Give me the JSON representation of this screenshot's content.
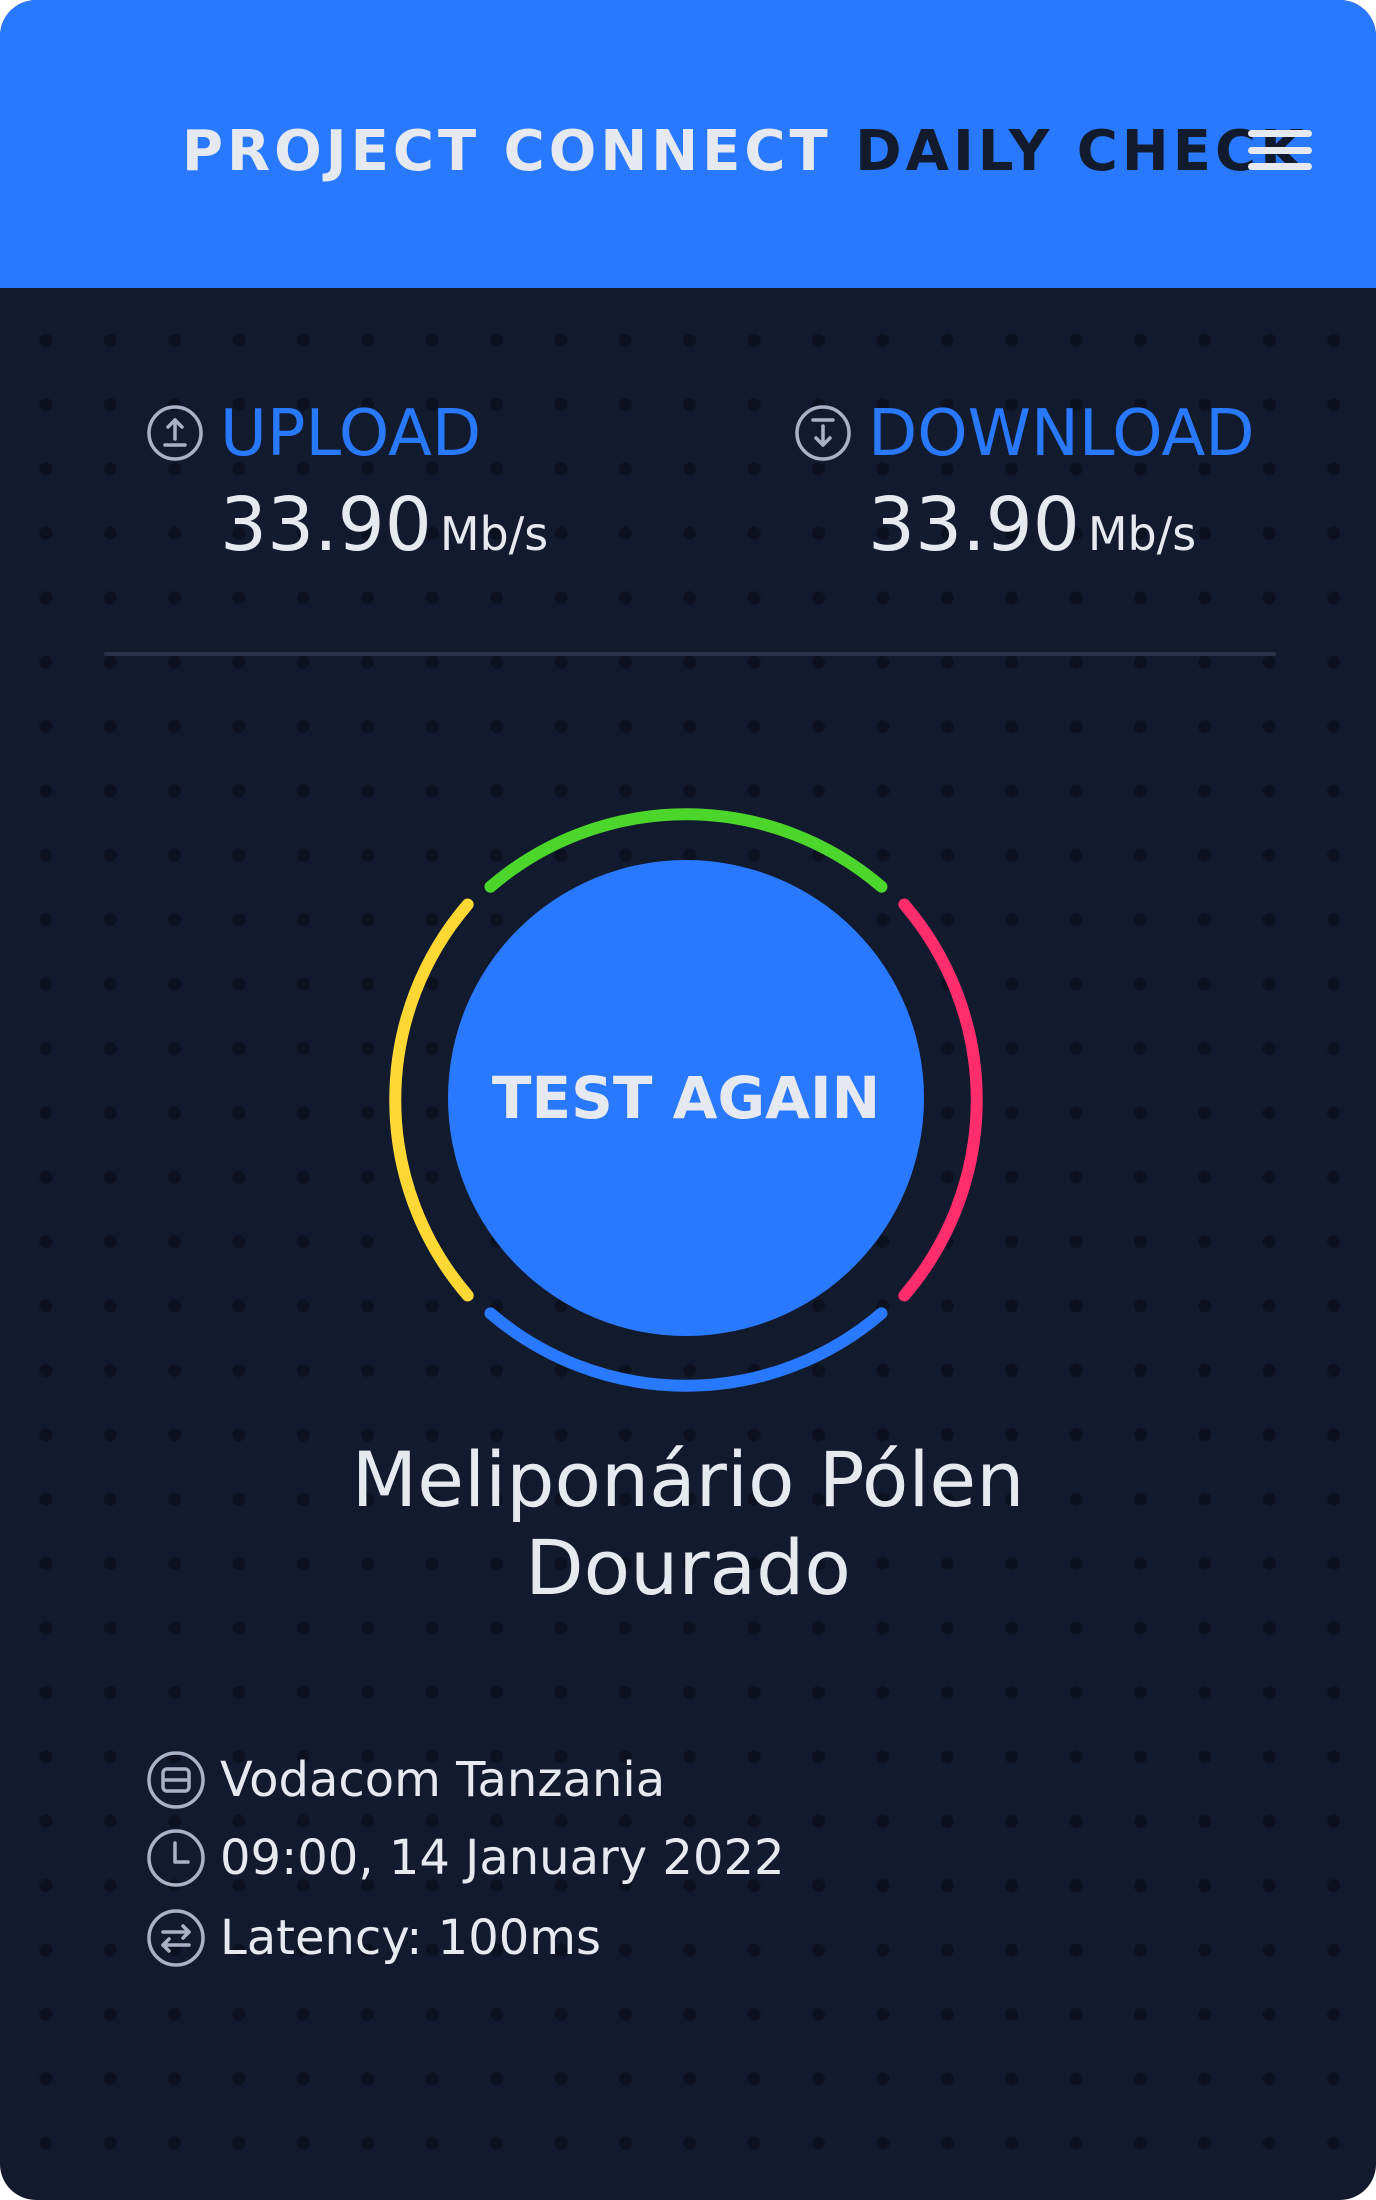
{
  "header": {
    "title_part1": "PROJECT CONNECT",
    "title_part2": "DAILY CHECK",
    "menu_icon": "hamburger-menu-icon"
  },
  "upload": {
    "icon": "upload-circle-icon",
    "label": "UPLOAD",
    "value": "33.90",
    "unit": "Mb/s"
  },
  "download": {
    "icon": "download-circle-icon",
    "label": "DOWNLOAD",
    "value": "33.90",
    "unit": "Mb/s"
  },
  "gauge": {
    "segment_colors": [
      "#4cd62b",
      "#ff2d6b",
      "#2979ff",
      "#fdd835"
    ]
  },
  "action": {
    "test_again_label": "TEST AGAIN"
  },
  "school": {
    "name_line1": "Meliponário Pólen",
    "name_line2": "Dourado"
  },
  "details": {
    "provider": "Vodacom Tanzania",
    "datetime": "09:00, 14 January 2022",
    "latency": "Latency: 100ms"
  },
  "colors": {
    "accent": "#2979ff",
    "background": "#121a2e",
    "text": "#e6e9f0"
  }
}
